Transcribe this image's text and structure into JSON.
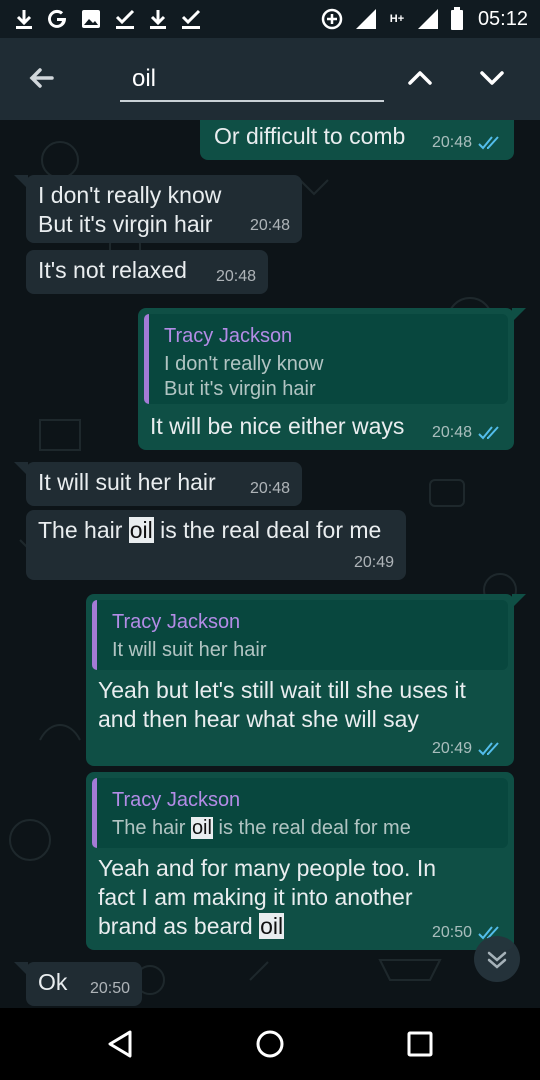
{
  "status_bar": {
    "time": "05:12",
    "network_label": "H+",
    "left_icons": [
      "download-icon",
      "google-icon",
      "image-icon",
      "check-download-icon",
      "download-icon",
      "check-download-icon"
    ],
    "right_icons": [
      "data-saver-icon",
      "signal-icon",
      "signal-icon",
      "battery-icon"
    ]
  },
  "search": {
    "query": "oil"
  },
  "messages": [
    {
      "dir": "out",
      "text": "Or difficult to comb",
      "time": "20:48",
      "read": true
    },
    {
      "dir": "in",
      "text": "I don't really know\nBut it's virgin hair",
      "time": "20:48"
    },
    {
      "dir": "in",
      "text": "It's not relaxed",
      "time": "20:48"
    },
    {
      "dir": "out",
      "quote_author": "Tracy Jackson",
      "quote_text": "I don't really know\nBut it's virgin hair",
      "text": "It will be nice either ways",
      "time": "20:48",
      "read": true
    },
    {
      "dir": "in",
      "text": "It will suit her hair",
      "time": "20:48"
    },
    {
      "dir": "in",
      "text_before": "The hair ",
      "text_highlight": "oil",
      "text_after": " is the real deal for me",
      "time": "20:49"
    },
    {
      "dir": "out",
      "quote_author": "Tracy Jackson",
      "quote_text": "It will suit her hair",
      "text": "Yeah but let's still wait till she uses it\nand then hear what she will say",
      "time": "20:49",
      "read": true
    },
    {
      "dir": "out",
      "quote_author": "Tracy Jackson",
      "quote_before": "The hair ",
      "quote_highlight": "oil",
      "quote_after": " is the real deal for me",
      "text_before": "Yeah and for many people too. In\nfact I am making it into another\nbrand as beard ",
      "text_highlight": "oil",
      "time": "20:50",
      "read": true
    },
    {
      "dir": "in",
      "text": "Ok",
      "time": "20:50"
    }
  ],
  "colors": {
    "incoming_bubble": "#202c33",
    "outgoing_bubble": "#0f4f45",
    "quote_author": "#b38ce6",
    "read_ticks": "#53bdeb",
    "highlight": "#e9edef"
  }
}
